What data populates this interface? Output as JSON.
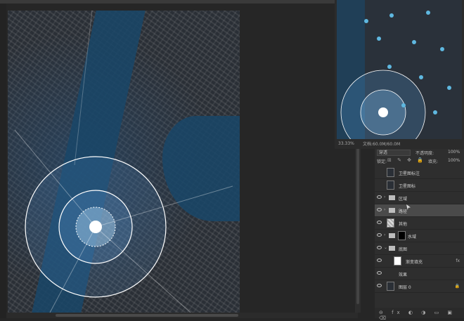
{
  "navigator": {
    "zoom": "33.33%",
    "doc_info": "文档:60.0M/60.0M"
  },
  "layers_panel": {
    "blend_mode": "穿透",
    "opacity_label": "不透明度:",
    "opacity_value": "100%",
    "lock_label": "锁定:",
    "lock_icons": "⊞ ✎ ✥ 🔒",
    "fill_label": "填充:",
    "fill_value": "100%",
    "layers": [
      {
        "name": "卫星图标注",
        "type": "layer",
        "visible": false,
        "thumb": "dark"
      },
      {
        "name": "卫星图标",
        "type": "layer",
        "visible": false,
        "thumb": "dark"
      },
      {
        "name": "区域",
        "type": "group",
        "visible": true
      },
      {
        "name": "路径",
        "type": "group",
        "visible": true,
        "selected": true
      },
      {
        "name": "其他",
        "type": "layer",
        "visible": true,
        "thumb": "checker"
      },
      {
        "name": "水域",
        "type": "group",
        "visible": true,
        "mask": true
      },
      {
        "name": "底图",
        "type": "group",
        "visible": true,
        "expanded": true
      },
      {
        "name": "渐变填充",
        "type": "layer",
        "visible": true,
        "thumb": "white",
        "indent": true
      },
      {
        "name": "效果",
        "type": "layer",
        "visible": true,
        "indent": true,
        "sub": true
      },
      {
        "name": "图层 0",
        "type": "layer",
        "visible": true,
        "thumb": "dark",
        "locked": true
      }
    ],
    "footer_icons": "⊖ fx ◐ ◑ ▭ ▣ ⌫"
  },
  "colors": {
    "app_bg": "#262626",
    "panel_bg": "#2e2e2e",
    "selected_layer": "#4a4a4a",
    "map_water": "#1a4669"
  }
}
